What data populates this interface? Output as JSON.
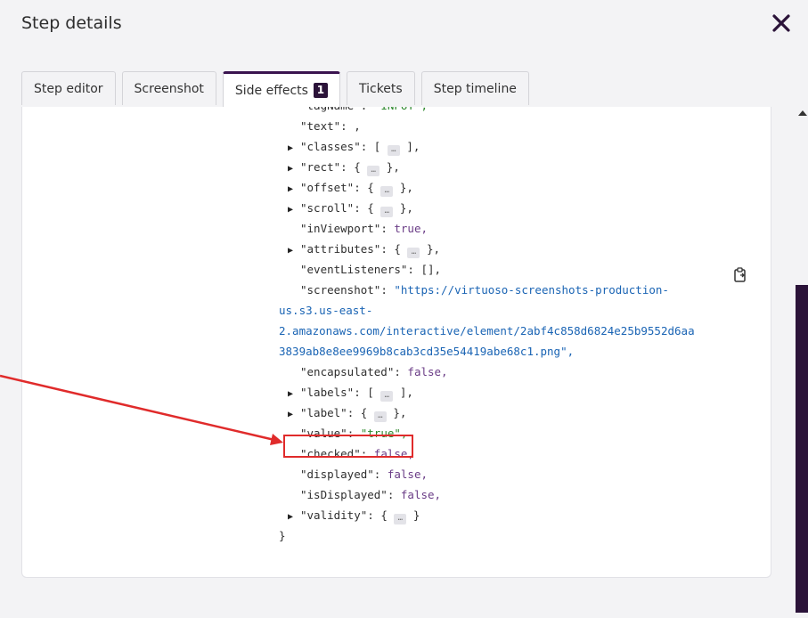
{
  "header": {
    "title": "Step details"
  },
  "tabs": [
    {
      "label": "Step editor"
    },
    {
      "label": "Screenshot"
    },
    {
      "label": "Side effects",
      "badge": "1"
    },
    {
      "label": "Tickets"
    },
    {
      "label": "Step timeline"
    }
  ],
  "code": {
    "lines": [
      {
        "key": "\"tagName\"",
        "sep": ": ",
        "val": "\"INPUT\",",
        "type": "str",
        "tri": false,
        "partial": true
      },
      {
        "key": "\"text\"",
        "sep": ": ,",
        "val": "",
        "type": "lit",
        "tri": false
      },
      {
        "key": "\"classes\"",
        "sep": ": [ ",
        "val": "],",
        "type": "coll",
        "tri": true
      },
      {
        "key": "\"rect\"",
        "sep": ": { ",
        "val": "},",
        "type": "coll",
        "tri": true
      },
      {
        "key": "\"offset\"",
        "sep": ": { ",
        "val": "},",
        "type": "coll",
        "tri": true
      },
      {
        "key": "\"scroll\"",
        "sep": ": { ",
        "val": "},",
        "type": "coll",
        "tri": true
      },
      {
        "key": "\"inViewport\"",
        "sep": ": ",
        "val": "true,",
        "type": "lit",
        "tri": false
      },
      {
        "key": "\"attributes\"",
        "sep": ": { ",
        "val": "},",
        "type": "coll",
        "tri": true
      },
      {
        "key": "\"eventListeners\"",
        "sep": ": [],",
        "val": "",
        "type": "lit",
        "tri": false
      },
      {
        "key": "\"screenshot\"",
        "sep": ": ",
        "val": "\"https://virtuoso-screenshots-production-",
        "type": "url",
        "tri": false
      },
      {
        "key": "",
        "sep": "",
        "val": "us.s3.us-east-",
        "type": "url",
        "tri": false,
        "indent": 1
      },
      {
        "key": "",
        "sep": "",
        "val": "2.amazonaws.com/interactive/element/2abf4c858d6824e25b9552d6aa",
        "type": "url",
        "tri": false,
        "indent": 1
      },
      {
        "key": "",
        "sep": "",
        "val": "3839ab8e8ee9969b8cab3cd35e54419abe68c1.png\",",
        "type": "url",
        "tri": false,
        "indent": 1
      },
      {
        "key": "\"encapsulated\"",
        "sep": ": ",
        "val": "false,",
        "type": "lit",
        "tri": false
      },
      {
        "key": "\"labels\"",
        "sep": ": [ ",
        "val": "],",
        "type": "coll",
        "tri": true
      },
      {
        "key": "\"label\"",
        "sep": ": { ",
        "val": "},",
        "type": "coll",
        "tri": true
      },
      {
        "key": "\"value\"",
        "sep": ": ",
        "val": "\"true\",",
        "type": "str",
        "tri": false
      },
      {
        "key": "\"checked\"",
        "sep": ": ",
        "val": "false,",
        "type": "lit",
        "tri": false
      },
      {
        "key": "\"displayed\"",
        "sep": ": ",
        "val": "false,",
        "type": "lit",
        "tri": false
      },
      {
        "key": "\"isDisplayed\"",
        "sep": ": ",
        "val": "false,",
        "type": "lit",
        "tri": false
      },
      {
        "key": "\"validity\"",
        "sep": ": { ",
        "val": "}",
        "type": "coll",
        "tri": true
      },
      {
        "key": "}",
        "sep": "",
        "val": "",
        "type": "close",
        "tri": false
      }
    ]
  },
  "colors": {
    "accent": "#2b1339",
    "annotation": "#e02b2b"
  }
}
